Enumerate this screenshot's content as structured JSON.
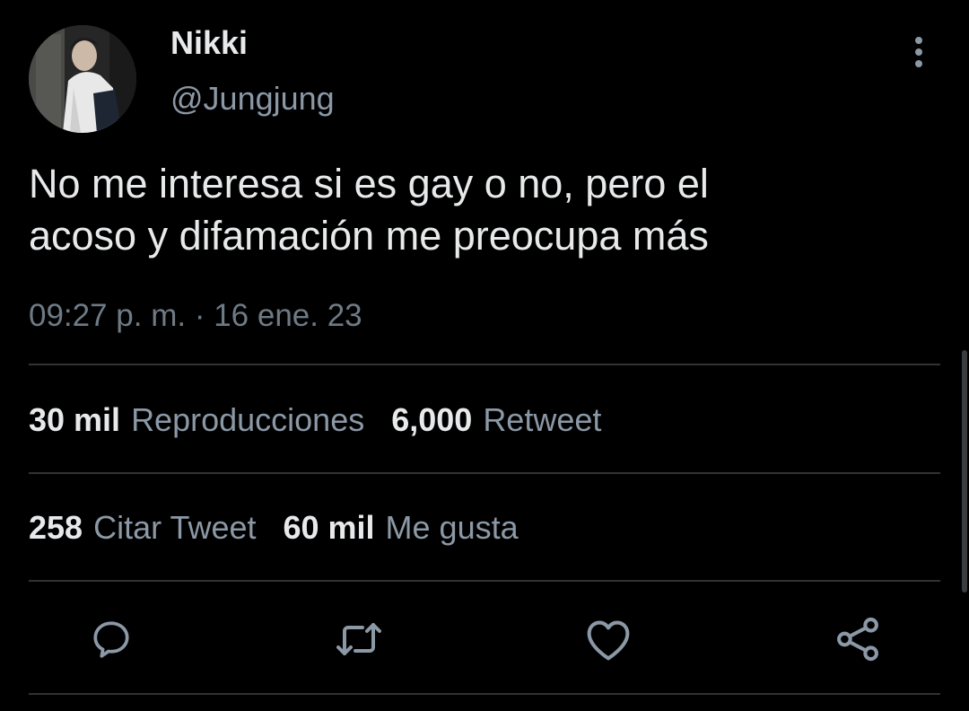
{
  "user": {
    "display_name": "Nikki",
    "handle": "@Jungjung"
  },
  "tweet": {
    "text_lines": [
      "No me interesa si es gay o no, pero el",
      "acoso y difamación me preocupa más"
    ],
    "timestamp": "09:27 p. m. · 16 ene. 23"
  },
  "stats": {
    "views_value": "30 mil",
    "views_label": "Reproducciones",
    "retweets_value": "6,000",
    "retweets_label": "Retweet",
    "quotes_value": "258",
    "quotes_label": "Citar Tweet",
    "likes_value": "60 mil",
    "likes_label": "Me gusta"
  },
  "icons": {
    "more": "more-vertical-icon",
    "reply": "reply-icon",
    "retweet": "retweet-icon",
    "like": "heart-icon",
    "share": "share-icon"
  },
  "colors": {
    "background": "#000000",
    "primary_text": "#e7e9ea",
    "secondary_text": "#8b98a5",
    "divider": "#2f3336",
    "icon": "#8b98a5"
  }
}
